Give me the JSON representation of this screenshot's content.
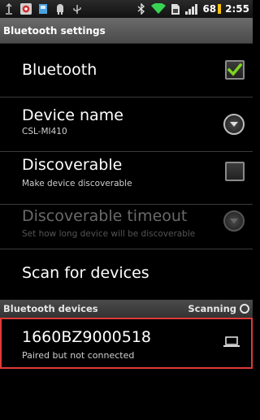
{
  "status_bar": {
    "icons": [
      "usb-icon",
      "notification-app-icon",
      "sd-card-icon",
      "android-debug-icon",
      "usb-connection-icon",
      "bluetooth-icon",
      "wifi-icon",
      "sim-icon",
      "signal-icon"
    ],
    "battery": "68",
    "time": "2:55"
  },
  "title": "Bluetooth settings",
  "settings": {
    "bluetooth": {
      "label": "Bluetooth",
      "checked": true
    },
    "device_name": {
      "label": "Device name",
      "value": "CSL-MI410"
    },
    "discoverable": {
      "label": "Discoverable",
      "summary": "Make device discoverable",
      "checked": false
    },
    "discoverable_timeout": {
      "label": "Discoverable timeout",
      "summary": "Set how long device will be discoverable",
      "enabled": false
    },
    "scan": {
      "label": "Scan for devices"
    }
  },
  "devices_section": {
    "header": "Bluetooth devices",
    "status": "Scanning"
  },
  "devices": [
    {
      "name": "1660BZ9000518",
      "status": "Paired but not connected",
      "icon": "laptop-icon"
    }
  ],
  "colors": {
    "highlight_border": "#e03a3a",
    "checkmark": "#7ed321"
  }
}
